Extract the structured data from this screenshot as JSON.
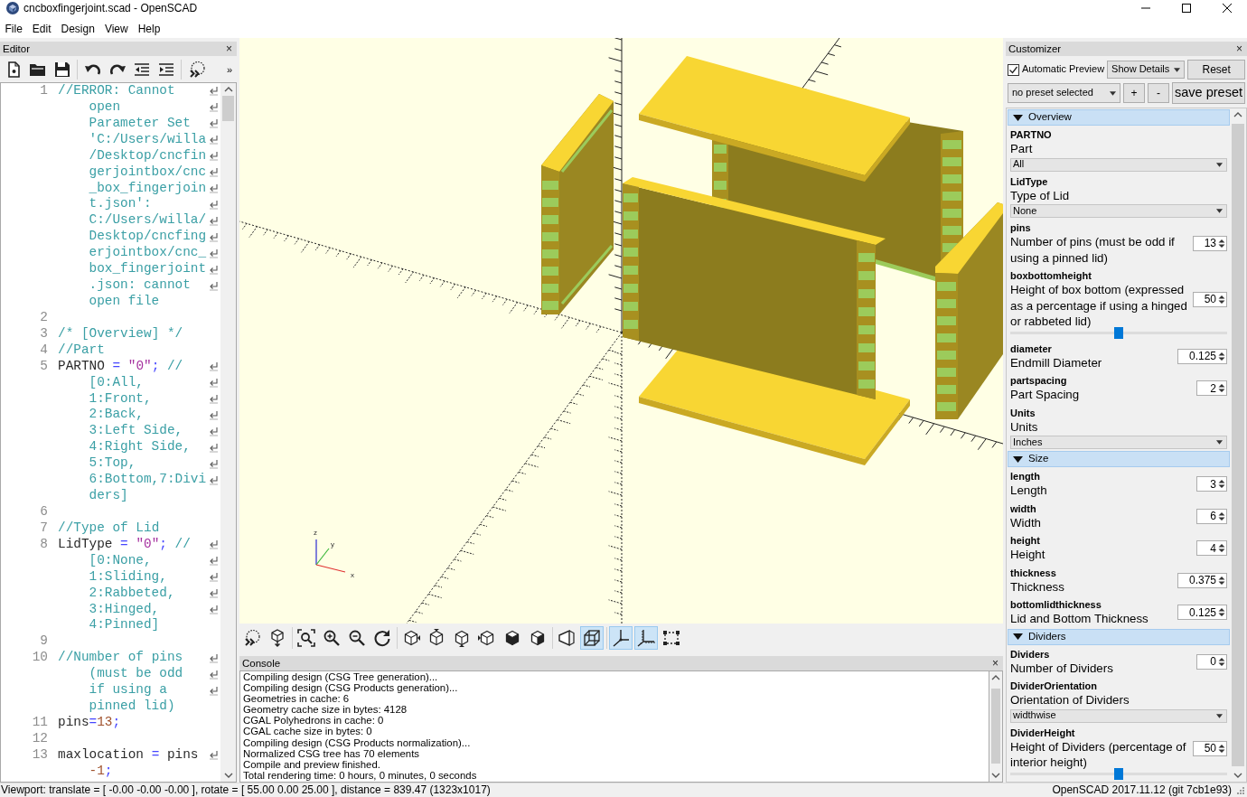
{
  "window": {
    "title": "cncboxfingerjoint.scad - OpenSCAD"
  },
  "menu": [
    "File",
    "Edit",
    "Design",
    "View",
    "Help"
  ],
  "editor": {
    "title": "Editor",
    "close_glyph": "×",
    "toolbar_overflow": "»",
    "lines": [
      {
        "number": "1",
        "rows": [
          {
            "parts": [
              {
                "kind": "comment",
                "text": "//ERROR: Cannot"
              }
            ]
          },
          {
            "parts": [
              {
                "kind": "comment",
                "text": "open"
              }
            ]
          },
          {
            "parts": [
              {
                "kind": "comment",
                "text": "Parameter Set"
              }
            ]
          },
          {
            "parts": [
              {
                "kind": "comment",
                "text": "'C:/Users/willa"
              }
            ]
          },
          {
            "parts": [
              {
                "kind": "comment",
                "text": "/Desktop/cncfin"
              }
            ]
          },
          {
            "parts": [
              {
                "kind": "comment",
                "text": "gerjointbox/cnc"
              }
            ]
          },
          {
            "parts": [
              {
                "kind": "comment",
                "text": "_box_fingerjoin"
              }
            ]
          },
          {
            "parts": [
              {
                "kind": "comment",
                "text": "t.json':"
              }
            ]
          },
          {
            "parts": [
              {
                "kind": "comment",
                "text": "C:/Users/willa/"
              }
            ]
          },
          {
            "parts": [
              {
                "kind": "comment",
                "text": "Desktop/cncfing"
              }
            ]
          },
          {
            "parts": [
              {
                "kind": "comment",
                "text": "erjointbox/cnc_"
              }
            ]
          },
          {
            "parts": [
              {
                "kind": "comment",
                "text": "box_fingerjoint"
              }
            ]
          },
          {
            "parts": [
              {
                "kind": "comment",
                "text": ".json: cannot"
              }
            ]
          },
          {
            "parts": [
              {
                "kind": "comment",
                "text": "open file"
              }
            ]
          }
        ]
      },
      {
        "number": "2"
      },
      {
        "number": "3",
        "rows": [
          {
            "parts": [
              {
                "kind": "comment",
                "text": "/* [Overview] */"
              }
            ]
          }
        ]
      },
      {
        "number": "4",
        "rows": [
          {
            "parts": [
              {
                "kind": "comment",
                "text": "//Part"
              }
            ]
          }
        ]
      },
      {
        "number": "5",
        "rows": [
          {
            "parts": [
              {
                "kind": "identifier",
                "text": "PARTNO"
              },
              {
                "kind": "operator",
                "text": " = "
              },
              {
                "kind": "string",
                "text": "\"0\""
              },
              {
                "kind": "operator",
                "text": ";"
              },
              {
                "kind": "comment",
                "text": " //"
              }
            ]
          },
          {
            "parts": [
              {
                "kind": "comment",
                "text": "[0:All,"
              }
            ]
          },
          {
            "parts": [
              {
                "kind": "comment",
                "text": "1:Front,"
              }
            ]
          },
          {
            "parts": [
              {
                "kind": "comment",
                "text": "2:Back,"
              }
            ]
          },
          {
            "parts": [
              {
                "kind": "comment",
                "text": "3:Left Side,"
              }
            ]
          },
          {
            "parts": [
              {
                "kind": "comment",
                "text": "4:Right Side,"
              }
            ]
          },
          {
            "parts": [
              {
                "kind": "comment",
                "text": "5:Top,"
              }
            ]
          },
          {
            "parts": [
              {
                "kind": "comment",
                "text": "6:Bottom,7:Divi"
              }
            ]
          },
          {
            "parts": [
              {
                "kind": "comment",
                "text": "ders]"
              }
            ]
          }
        ]
      },
      {
        "number": "6"
      },
      {
        "number": "7",
        "rows": [
          {
            "parts": [
              {
                "kind": "comment",
                "text": "//Type of Lid"
              }
            ]
          }
        ]
      },
      {
        "number": "8",
        "rows": [
          {
            "parts": [
              {
                "kind": "identifier",
                "text": "LidType"
              },
              {
                "kind": "operator",
                "text": " = "
              },
              {
                "kind": "string",
                "text": "\"0\""
              },
              {
                "kind": "operator",
                "text": ";"
              },
              {
                "kind": "comment",
                "text": " //"
              }
            ]
          },
          {
            "parts": [
              {
                "kind": "comment",
                "text": "[0:None,"
              }
            ]
          },
          {
            "parts": [
              {
                "kind": "comment",
                "text": "1:Sliding,"
              }
            ]
          },
          {
            "parts": [
              {
                "kind": "comment",
                "text": "2:Rabbeted,"
              }
            ]
          },
          {
            "parts": [
              {
                "kind": "comment",
                "text": "3:Hinged,"
              }
            ]
          },
          {
            "parts": [
              {
                "kind": "comment",
                "text": "4:Pinned]"
              }
            ]
          }
        ]
      },
      {
        "number": "9"
      },
      {
        "number": "10",
        "rows": [
          {
            "parts": [
              {
                "kind": "comment",
                "text": "//Number of pins"
              }
            ]
          },
          {
            "parts": [
              {
                "kind": "comment",
                "text": "(must be odd"
              }
            ]
          },
          {
            "parts": [
              {
                "kind": "comment",
                "text": "if using a"
              }
            ]
          },
          {
            "parts": [
              {
                "kind": "comment",
                "text": "pinned lid)"
              }
            ]
          }
        ]
      },
      {
        "number": "11",
        "rows": [
          {
            "parts": [
              {
                "kind": "identifier",
                "text": "pins"
              },
              {
                "kind": "operator",
                "text": "="
              },
              {
                "kind": "number",
                "text": "13"
              },
              {
                "kind": "operator",
                "text": ";"
              }
            ]
          }
        ]
      },
      {
        "number": "12"
      },
      {
        "number": "13",
        "rows": [
          {
            "parts": [
              {
                "kind": "identifier",
                "text": "maxlocation"
              },
              {
                "kind": "operator",
                "text": " = "
              },
              {
                "kind": "identifier",
                "text": "pins"
              }
            ]
          },
          {
            "parts": [
              {
                "kind": "number",
                "text": "-1"
              },
              {
                "kind": "operator",
                "text": ";"
              }
            ]
          }
        ]
      }
    ]
  },
  "viewport": {
    "axis_labels": [
      "z",
      "y",
      "x"
    ],
    "toolbar_groups": [
      [
        {
          "on": false
        },
        {
          "on": false
        }
      ],
      [
        {
          "on": false
        },
        {
          "on": false
        },
        {
          "on": false
        },
        {
          "on": false
        }
      ],
      [
        {
          "on": false
        },
        {
          "on": false
        },
        {
          "on": false
        },
        {
          "on": false
        },
        {
          "on": false
        },
        {
          "on": false
        }
      ],
      [
        {
          "on": false
        },
        {
          "on": true
        }
      ],
      [
        {
          "on": true
        },
        {
          "on": true
        },
        {
          "on": false
        }
      ]
    ]
  },
  "console": {
    "title": "Console",
    "close_glyph": "×",
    "lines": [
      "Compiling design (CSG Tree generation)...",
      "Compiling design (CSG Products generation)...",
      "Geometries in cache: 6",
      "Geometry cache size in bytes: 4128",
      "CGAL Polyhedrons in cache: 0",
      "CGAL cache size in bytes: 0",
      "Compiling design (CSG Products normalization)...",
      "Normalized CSG tree has 70 elements",
      "Compile and preview finished.",
      "Total rendering time: 0 hours, 0 minutes, 0 seconds"
    ]
  },
  "customizer": {
    "title": "Customizer",
    "close_glyph": "×",
    "automatic_preview": {
      "label": "Automatic Preview",
      "checked": true
    },
    "details_dropdown": "Show Details",
    "reset_button": "Reset",
    "preset_dropdown": "no preset selected",
    "preset_buttons": [
      "+",
      "-"
    ],
    "save_button": "save preset",
    "groups": [
      {
        "title": "Overview",
        "expanded": true,
        "params": [
          {
            "name": "PARTNO",
            "description": "Part",
            "kind": "dropdown",
            "value": "All"
          },
          {
            "name": "LidType",
            "description": "Type of Lid",
            "kind": "dropdown",
            "value": "None"
          },
          {
            "name": "pins",
            "description": "Number of pins (must be odd if using a pinned lid)",
            "kind": "spinbox",
            "value": "13"
          },
          {
            "name": "boxbottomheight",
            "description": "Height of box bottom (expressed as a percentage if using a hinged or rabbeted lid)",
            "kind": "slider",
            "value": "50",
            "level": 0.5
          },
          {
            "name": "diameter",
            "description": "Endmill Diameter",
            "kind": "spinbox",
            "value": "0.125"
          },
          {
            "name": "partspacing",
            "description": "Part Spacing",
            "kind": "spinbox",
            "value": "2"
          },
          {
            "name": "Units",
            "description": "Units",
            "kind": "dropdown",
            "value": "Inches"
          }
        ]
      },
      {
        "title": "Size",
        "expanded": true,
        "params": [
          {
            "name": "length",
            "description": "Length",
            "kind": "spinbox",
            "value": "3"
          },
          {
            "name": "width",
            "description": "Width",
            "kind": "spinbox",
            "value": "6"
          },
          {
            "name": "height",
            "description": "Height",
            "kind": "spinbox",
            "value": "4"
          },
          {
            "name": "thickness",
            "description": "Thickness",
            "kind": "spinbox",
            "value": "0.375"
          },
          {
            "name": "bottomlidthickness",
            "description": "Lid and Bottom Thickness",
            "kind": "spinbox",
            "value": "0.125"
          }
        ]
      },
      {
        "title": "Dividers",
        "expanded": true,
        "params": [
          {
            "name": "Dividers",
            "description": "Number of Dividers",
            "kind": "spinbox",
            "value": "0"
          },
          {
            "name": "DividerOrientation",
            "description": "Orientation of Dividers",
            "kind": "dropdown",
            "value": "widthwise"
          },
          {
            "name": "DividerHeight",
            "description": "Height of Dividers (percentage of interior height)",
            "kind": "slider",
            "value": "50",
            "level": 0.5
          }
        ]
      }
    ]
  },
  "status_bar": {
    "viewport": "Viewport: translate = [ -0.00 -0.00 -0.00 ], rotate = [ 55.00 0.00 25.00 ], distance = 839.47 (1323x1017)",
    "version": "OpenSCAD 2017.11.12 (git 7cb1e93)"
  }
}
